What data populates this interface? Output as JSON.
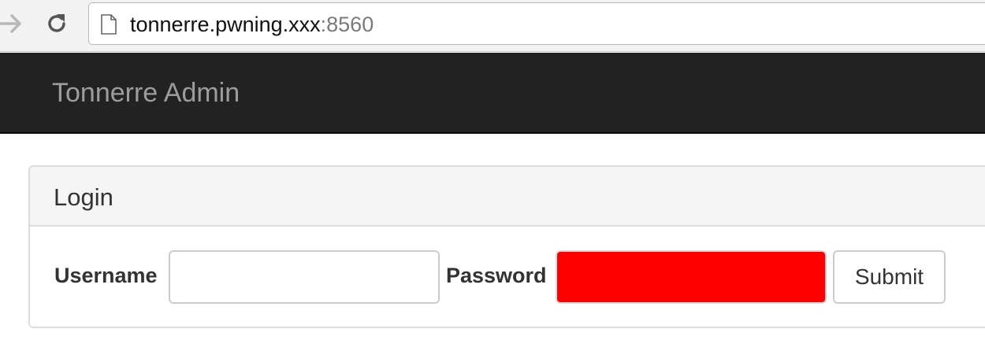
{
  "browser": {
    "url_host": "tonnerre.pwning.xxx",
    "url_port": ":8560",
    "forward_icon": "forward-arrow-icon",
    "reload_icon": "reload-icon",
    "page_icon": "document-icon"
  },
  "navbar": {
    "brand": "Tonnerre Admin",
    "background": "#222222",
    "brand_color": "#9d9d9d"
  },
  "login": {
    "title": "Login",
    "username_label": "Username",
    "username_value": "",
    "password_label": "Password",
    "password_value": "",
    "password_fill_color": "#ff0000",
    "submit_label": "Submit"
  }
}
